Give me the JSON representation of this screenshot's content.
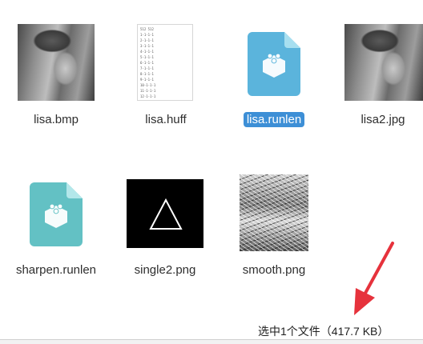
{
  "files": [
    {
      "name": "lisa.bmp",
      "icon": "image-thumbnail",
      "selected": false
    },
    {
      "name": "lisa.huff",
      "icon": "text-document-thumbnail",
      "selected": false,
      "preview_lines": [
        "512 512",
        "1-1-1-1",
        "2-1-1-1",
        "3-1-1-1",
        "4-1-1-1",
        "5-1-1-1",
        "6-1-1-1",
        "7-1-1-1",
        "8-1-1-1",
        "9-1-1-1",
        "10-1-1-1",
        "11-1-1-1",
        "12-1-1-1"
      ]
    },
    {
      "name": "lisa.runlen",
      "icon": "generic-file-icon",
      "selected": true
    },
    {
      "name": "lisa2.jpg",
      "icon": "image-thumbnail",
      "selected": false
    },
    {
      "name": "sharpen.runlen",
      "icon": "generic-file-icon",
      "selected": false
    },
    {
      "name": "single2.png",
      "icon": "triangle-image-thumbnail",
      "selected": false
    },
    {
      "name": "smooth.png",
      "icon": "image-thumbnail",
      "selected": false
    }
  ],
  "status_text": "选中1个文件（417.7 KB）",
  "colors": {
    "selection": "#3d8fd6",
    "doc_icon_selected": "#5bb4dc",
    "doc_icon": "#63c1c4",
    "arrow": "#e6323c"
  }
}
